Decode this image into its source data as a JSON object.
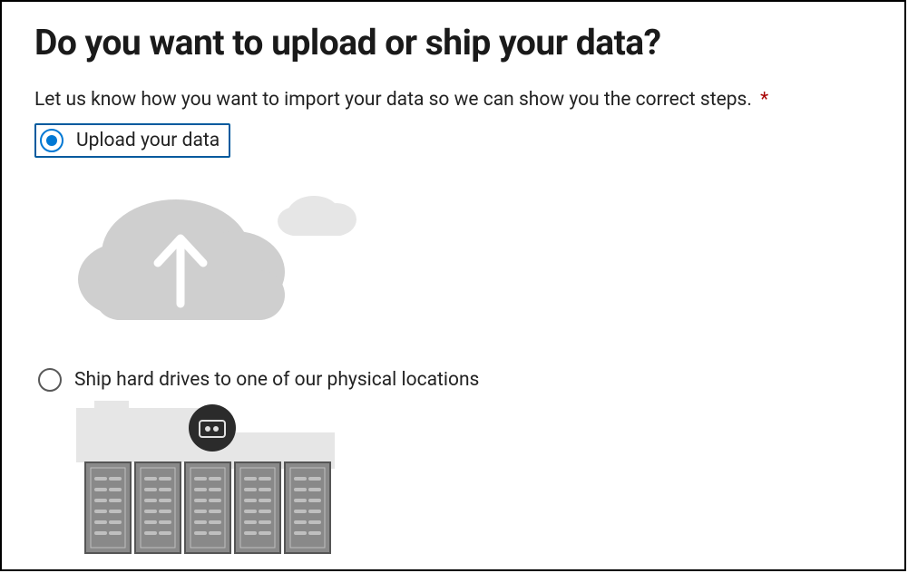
{
  "title": "Do you want to upload or ship your data?",
  "subtitle": "Let us know how you want to import your data so we can show you the correct steps.",
  "required_mark": "*",
  "options": [
    {
      "id": "upload",
      "label": "Upload your data",
      "selected": true
    },
    {
      "id": "ship",
      "label": "Ship hard drives to one of our physical locations",
      "selected": false
    }
  ],
  "accent": "#0078d4"
}
